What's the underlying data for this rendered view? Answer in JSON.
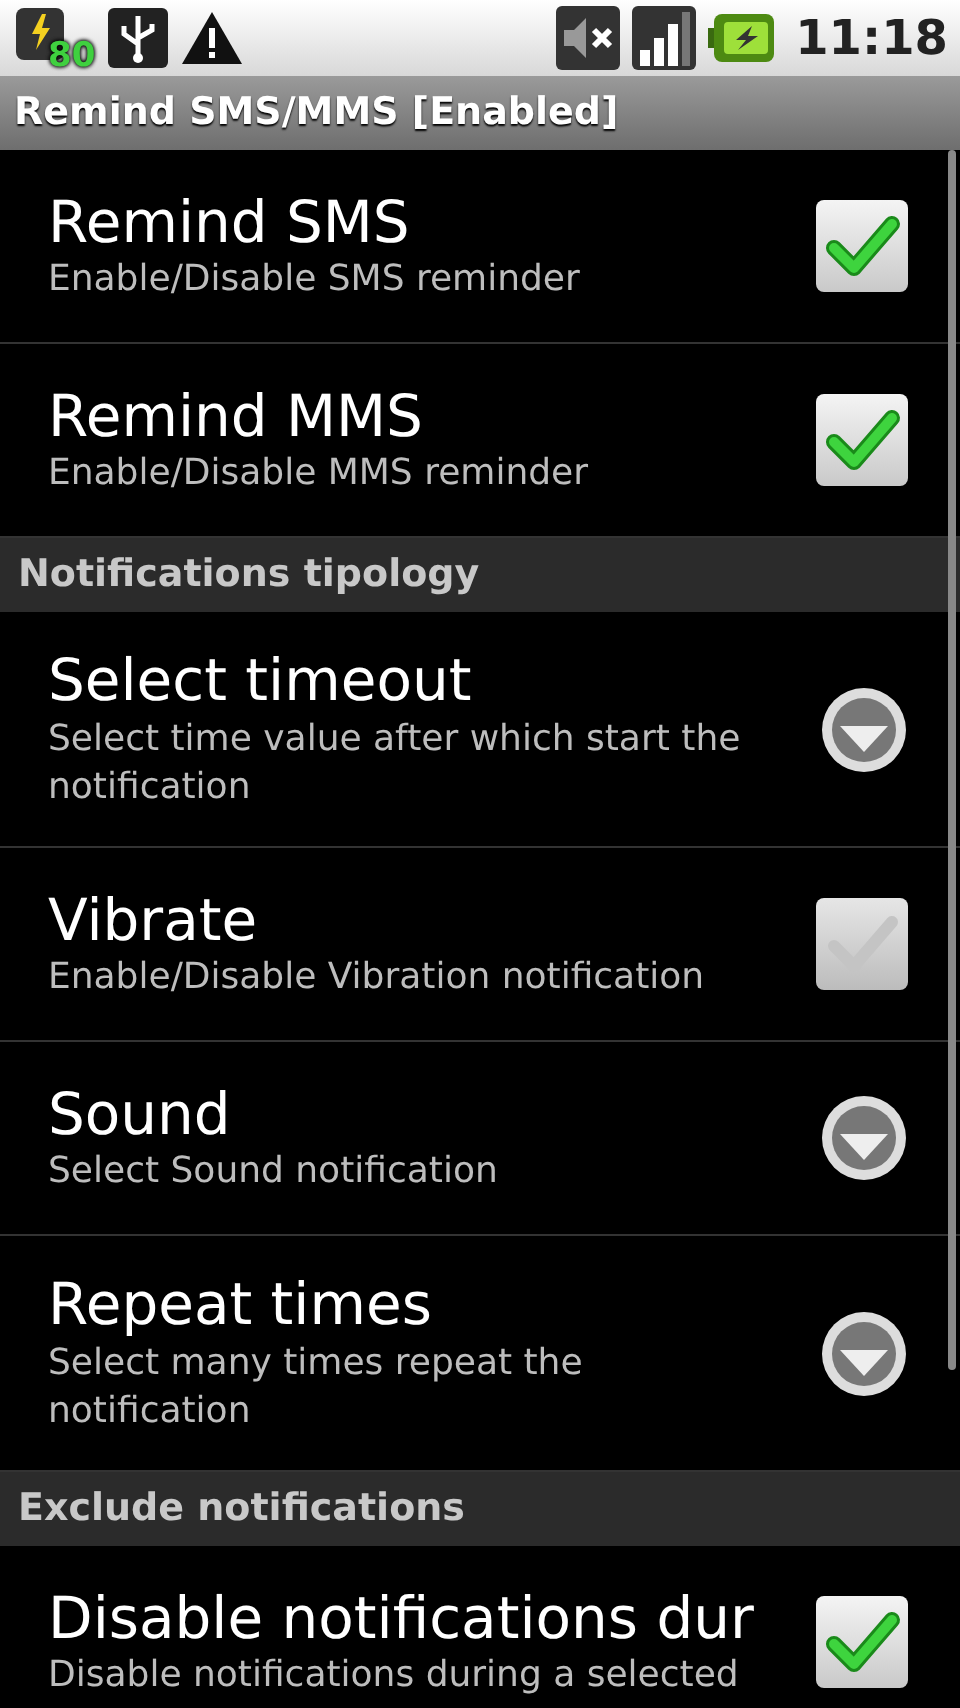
{
  "status_bar": {
    "battery_level_badge": "80",
    "time": "11:18"
  },
  "title": "Remind SMS/MMS [Enabled]",
  "items": [
    {
      "kind": "checkbox",
      "title": "Remind SMS",
      "summary": "Enable/Disable SMS reminder",
      "checked": true
    },
    {
      "kind": "checkbox",
      "title": "Remind MMS",
      "summary": "Enable/Disable MMS reminder",
      "checked": true
    },
    {
      "kind": "header",
      "title": "Notifications tipology"
    },
    {
      "kind": "dropdown",
      "title": "Select timeout",
      "summary": "Select time value after which start the notification"
    },
    {
      "kind": "checkbox",
      "title": "Vibrate",
      "summary": "Enable/Disable Vibration notification",
      "checked": false
    },
    {
      "kind": "dropdown",
      "title": "Sound",
      "summary": "Select Sound notification"
    },
    {
      "kind": "dropdown",
      "title": "Repeat times",
      "summary": "Select many times repeat the notification"
    },
    {
      "kind": "header",
      "title": "Exclude notifications"
    },
    {
      "kind": "checkbox",
      "title": "Disable notifications dur",
      "summary": "Disable notifications during a selected",
      "checked": true
    }
  ]
}
